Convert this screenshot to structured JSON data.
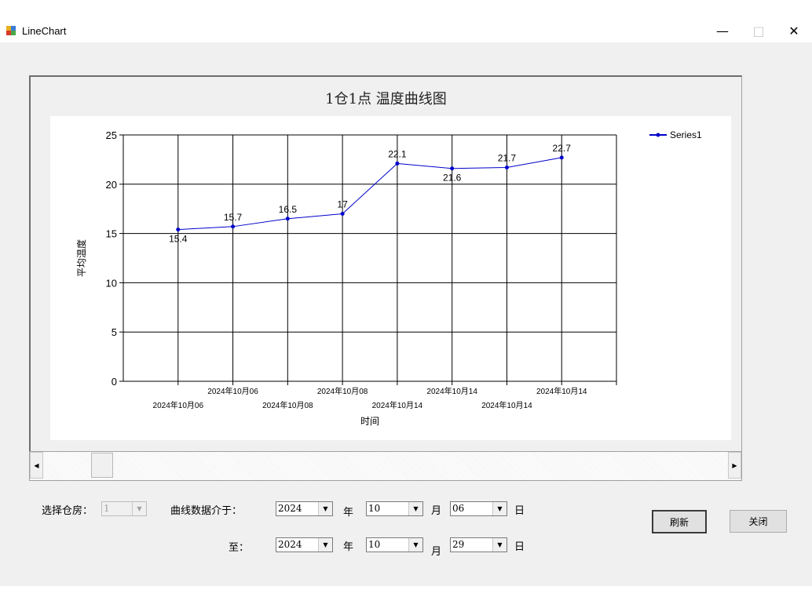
{
  "window": {
    "title": "LineChart",
    "minimize": "—",
    "maximize": "□",
    "close": "✕"
  },
  "chart": {
    "title": "1仓1点    温度曲线图"
  },
  "chart_data": {
    "type": "line",
    "title": "1仓1点    温度曲线图",
    "xlabel": "时间",
    "ylabel": "平均温度",
    "ylim": [
      0,
      25
    ],
    "yticks": [
      0,
      5,
      10,
      15,
      20,
      25
    ],
    "xlim": [
      0,
      9
    ],
    "grid": true,
    "legend_position": "top-right",
    "x_tick_labels": [
      {
        "x": 1,
        "label": "2024年10月06"
      },
      {
        "x": 2,
        "label": "2024年10月06"
      },
      {
        "x": 3,
        "label": "2024年10月08"
      },
      {
        "x": 4,
        "label": "2024年10月08"
      },
      {
        "x": 5,
        "label": "2024年10月14"
      },
      {
        "x": 6,
        "label": "2024年10月14"
      },
      {
        "x": 7,
        "label": "2024年10月14"
      },
      {
        "x": 8,
        "label": "2024年10月14"
      }
    ],
    "series": [
      {
        "name": "Series1",
        "color": "#0000cc",
        "x": [
          1,
          2,
          3,
          4,
          5,
          6,
          7,
          8
        ],
        "values": [
          15.4,
          15.7,
          16.5,
          17,
          22.1,
          21.6,
          21.7,
          22.7
        ],
        "labels": [
          "15.4",
          "15.7",
          "16.5",
          "17",
          "22.1",
          "21.6",
          "21.7",
          "22.7"
        ]
      }
    ]
  },
  "scrollbar": {
    "left_arrow": "◀",
    "right_arrow": "▶"
  },
  "controls": {
    "warehouse_label": "选择仓房：",
    "warehouse_value": "1",
    "range_label": "曲线数据介于：",
    "to_label": "至：",
    "from_year": "2024",
    "from_month": "10",
    "from_day": "06",
    "to_year": "2024",
    "to_month": "10",
    "to_day": "29",
    "year_unit": "年",
    "month_unit": "月",
    "day_unit": "日",
    "dropdown_arrow": "▼",
    "refresh_label": "刷新",
    "close_label": "关闭"
  }
}
